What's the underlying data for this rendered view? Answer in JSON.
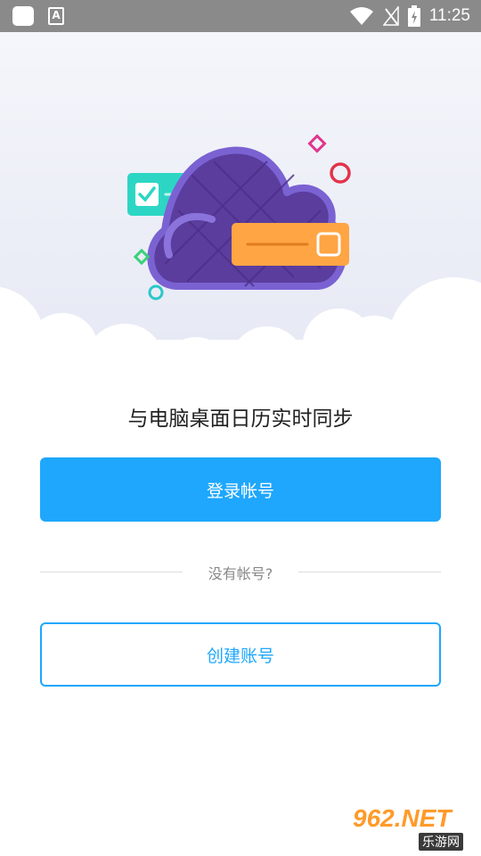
{
  "status_bar": {
    "time": "11:25",
    "icons": [
      "app-square-icon",
      "a-notification-icon",
      "wifi-icon",
      "no-signal-icon",
      "battery-charging-icon"
    ]
  },
  "hero": {
    "icons": [
      "cloud-illustration-icon",
      "checkbox-card-icon",
      "orange-card-icon",
      "pink-diamond-icon",
      "red-ring-icon",
      "green-diamond-icon",
      "teal-ring-icon"
    ]
  },
  "main": {
    "tagline": "与电脑桌面日历实时同步",
    "login_button": "登录帐号",
    "divider_text": "没有帐号?",
    "create_button": "创建账号"
  },
  "watermark": {
    "brand": "962.NET",
    "sub": "乐游网"
  },
  "colors": {
    "accent": "#1ea7fd",
    "status_bar": "#8a8a8a",
    "cloud": "#5b3d9e",
    "cloud_outline": "#7b62d2",
    "card_teal": "#2dd6c4",
    "card_orange": "#ffa544"
  }
}
